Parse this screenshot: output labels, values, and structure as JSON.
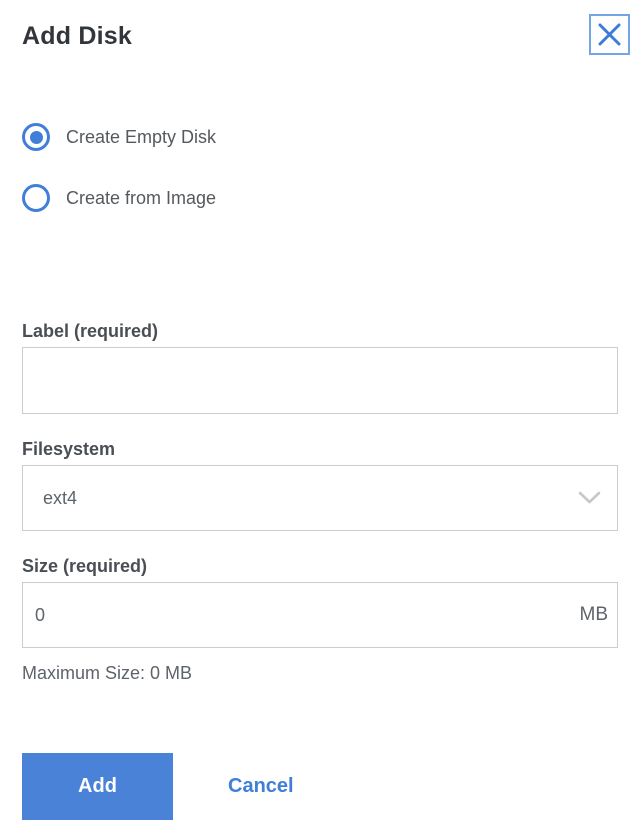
{
  "dialog": {
    "title": "Add Disk"
  },
  "radio_group": {
    "options": [
      {
        "label": "Create Empty Disk",
        "selected": true
      },
      {
        "label": "Create from Image",
        "selected": false
      }
    ]
  },
  "fields": {
    "label": {
      "label": "Label (required)",
      "value": "",
      "placeholder": ""
    },
    "filesystem": {
      "label": "Filesystem",
      "value": "ext4"
    },
    "size": {
      "label": "Size (required)",
      "value": "0",
      "unit": "MB",
      "helper": "Maximum Size: 0 MB"
    }
  },
  "actions": {
    "add_label": "Add",
    "cancel_label": "Cancel"
  },
  "icons": {
    "close": "close-icon",
    "chevron": "chevron-down-icon"
  },
  "colors": {
    "accent_blue": "#3f7fd9",
    "button_blue": "#4a82d8",
    "title_text": "#32363c",
    "label_text": "#4a4f55",
    "body_text": "#5e646b",
    "input_border": "#cccccc"
  }
}
